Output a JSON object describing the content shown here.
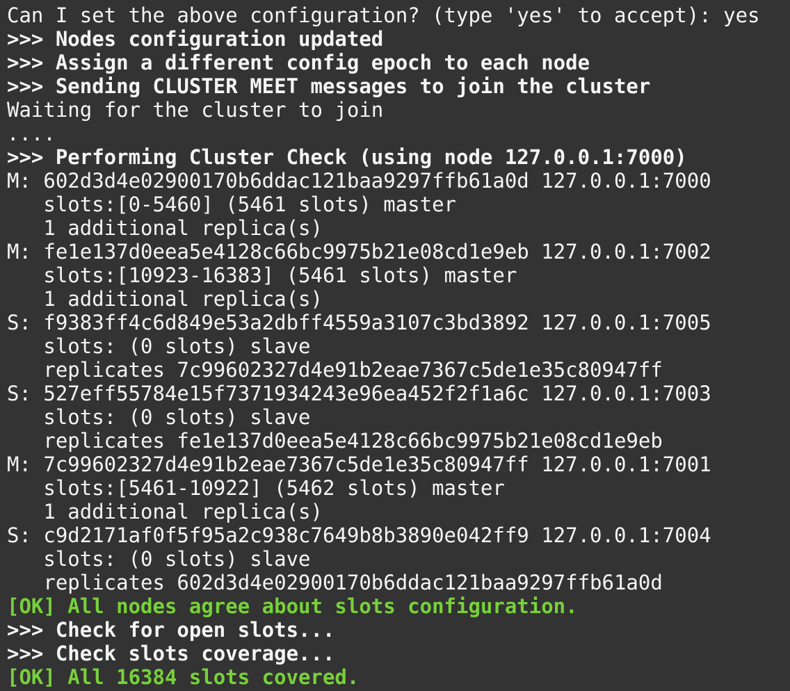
{
  "terminal": {
    "background_color": "#333333",
    "default_text_color": "#f5f5f5",
    "success_text_color": "#77d13a",
    "lines": [
      {
        "text": "Can I set the above configuration? (type 'yes' to accept): yes",
        "color": "white",
        "weight": "normal"
      },
      {
        "text": ">>> Nodes configuration updated",
        "color": "white",
        "weight": "bold"
      },
      {
        "text": ">>> Assign a different config epoch to each node",
        "color": "white",
        "weight": "bold"
      },
      {
        "text": ">>> Sending CLUSTER MEET messages to join the cluster",
        "color": "white",
        "weight": "bold"
      },
      {
        "text": "Waiting for the cluster to join",
        "color": "white",
        "weight": "normal"
      },
      {
        "text": "....",
        "color": "white",
        "weight": "normal"
      },
      {
        "text": ">>> Performing Cluster Check (using node 127.0.0.1:7000)",
        "color": "white",
        "weight": "bold"
      },
      {
        "text": "M: 602d3d4e02900170b6ddac121baa9297ffb61a0d 127.0.0.1:7000",
        "color": "white",
        "weight": "normal"
      },
      {
        "text": "   slots:[0-5460] (5461 slots) master",
        "color": "white",
        "weight": "normal"
      },
      {
        "text": "   1 additional replica(s)",
        "color": "white",
        "weight": "normal"
      },
      {
        "text": "M: fe1e137d0eea5e4128c66bc9975b21e08cd1e9eb 127.0.0.1:7002",
        "color": "white",
        "weight": "normal"
      },
      {
        "text": "   slots:[10923-16383] (5461 slots) master",
        "color": "white",
        "weight": "normal"
      },
      {
        "text": "   1 additional replica(s)",
        "color": "white",
        "weight": "normal"
      },
      {
        "text": "S: f9383ff4c6d849e53a2dbff4559a3107c3bd3892 127.0.0.1:7005",
        "color": "white",
        "weight": "normal"
      },
      {
        "text": "   slots: (0 slots) slave",
        "color": "white",
        "weight": "normal"
      },
      {
        "text": "   replicates 7c99602327d4e91b2eae7367c5de1e35c80947ff",
        "color": "white",
        "weight": "normal"
      },
      {
        "text": "S: 527eff55784e15f7371934243e96ea452f2f1a6c 127.0.0.1:7003",
        "color": "white",
        "weight": "normal"
      },
      {
        "text": "   slots: (0 slots) slave",
        "color": "white",
        "weight": "normal"
      },
      {
        "text": "   replicates fe1e137d0eea5e4128c66bc9975b21e08cd1e9eb",
        "color": "white",
        "weight": "normal"
      },
      {
        "text": "M: 7c99602327d4e91b2eae7367c5de1e35c80947ff 127.0.0.1:7001",
        "color": "white",
        "weight": "normal"
      },
      {
        "text": "   slots:[5461-10922] (5462 slots) master",
        "color": "white",
        "weight": "normal"
      },
      {
        "text": "   1 additional replica(s)",
        "color": "white",
        "weight": "normal"
      },
      {
        "text": "S: c9d2171af0f5f95a2c938c7649b8b3890e042ff9 127.0.0.1:7004",
        "color": "white",
        "weight": "normal"
      },
      {
        "text": "   slots: (0 slots) slave",
        "color": "white",
        "weight": "normal"
      },
      {
        "text": "   replicates 602d3d4e02900170b6ddac121baa9297ffb61a0d",
        "color": "white",
        "weight": "normal"
      },
      {
        "text": "[OK] All nodes agree about slots configuration.",
        "color": "green",
        "weight": "bold"
      },
      {
        "text": ">>> Check for open slots...",
        "color": "white",
        "weight": "bold"
      },
      {
        "text": ">>> Check slots coverage...",
        "color": "white",
        "weight": "bold"
      },
      {
        "text": "[OK] All 16384 slots covered.",
        "color": "green",
        "weight": "bold"
      }
    ]
  }
}
